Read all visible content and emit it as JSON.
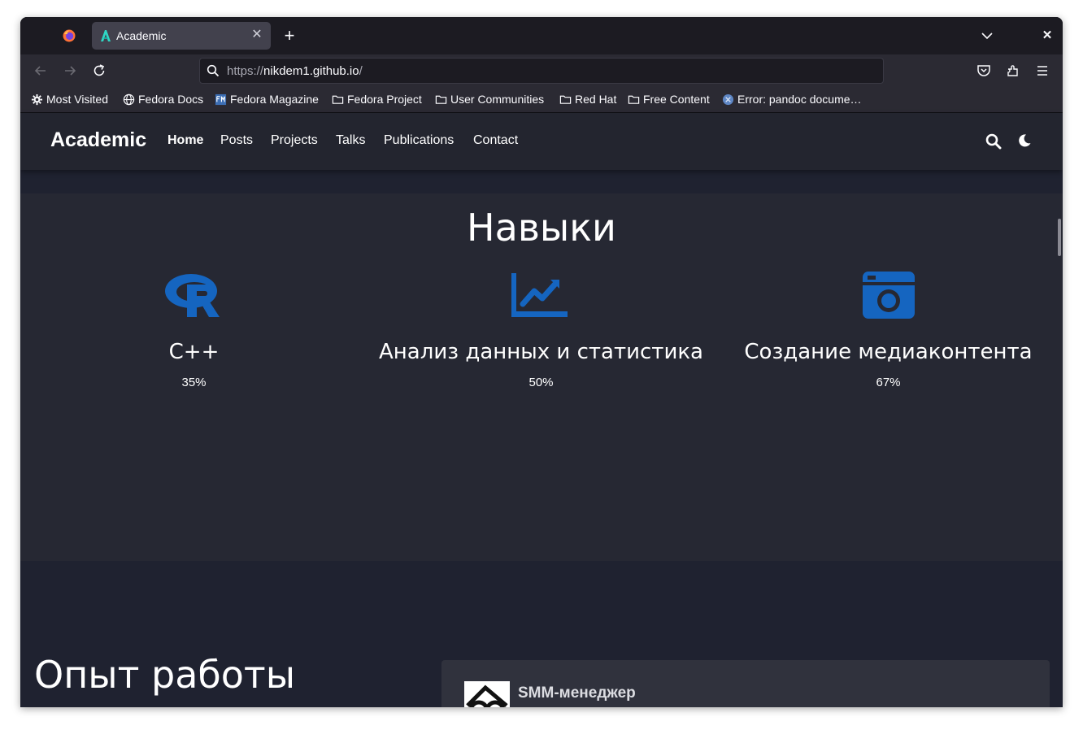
{
  "browser": {
    "tab": {
      "title": "Academic"
    },
    "url": {
      "protocol": "https://",
      "host": "nikdem1.github.io",
      "path": "/"
    },
    "bookmarks": [
      {
        "label": "Most Visited",
        "icon": "gear-icon"
      },
      {
        "label": "Fedora Docs",
        "icon": "globe-icon"
      },
      {
        "label": "Fedora Magazine",
        "icon": "fm-icon"
      },
      {
        "label": "Fedora Project",
        "icon": "folder-icon"
      },
      {
        "label": "User Communities",
        "icon": "folder-icon"
      },
      {
        "label": "Red Hat",
        "icon": "folder-icon"
      },
      {
        "label": "Free Content",
        "icon": "folder-icon"
      },
      {
        "label": "Error: pandoc docume…",
        "icon": "page-icon"
      }
    ]
  },
  "site": {
    "brand": "Academic",
    "menu": [
      "Home",
      "Posts",
      "Projects",
      "Talks",
      "Publications",
      "Contact"
    ],
    "accent": "#1565c0"
  },
  "skills": {
    "title": "Навыки",
    "items": [
      {
        "name": "C++",
        "percent": "35%",
        "icon": "r-logo-icon"
      },
      {
        "name": "Анализ данных и статистика",
        "percent": "50%",
        "icon": "chart-line-icon"
      },
      {
        "name": "Создание медиаконтента",
        "percent": "67%",
        "icon": "camera-icon"
      }
    ]
  },
  "experience": {
    "title": "Опыт работы",
    "first_role": "SMM-менеджер"
  }
}
